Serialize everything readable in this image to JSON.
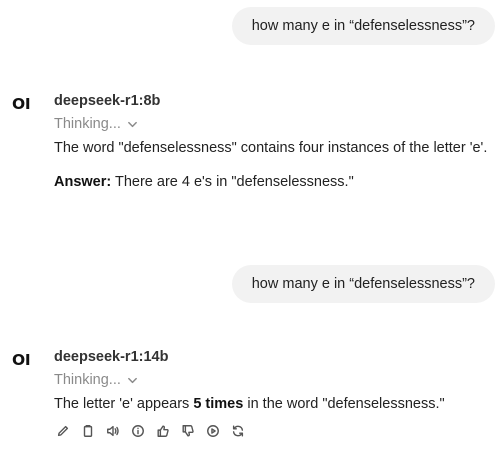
{
  "conversation": {
    "user_messages": [
      {
        "text": "how many e in “defenselessness”?"
      },
      {
        "text": "how many e in “defenselessness”?"
      }
    ],
    "assistant_messages": [
      {
        "avatar": "OI",
        "model": "deepseek-r1:8b",
        "thinking_label": "Thinking...",
        "text": "The word \"defenselessness\" contains four instances of the letter 'e'.",
        "answer_label": "Answer:",
        "answer_text": " There are 4 e's in \"defenselessness.\""
      },
      {
        "avatar": "OI",
        "model": "deepseek-r1:14b",
        "thinking_label": "Thinking...",
        "text_before": "The letter 'e' appears ",
        "text_bold": "5 times",
        "text_after": " in the word \"defenselessness.\""
      }
    ]
  },
  "actions": {
    "icons": [
      "edit-icon",
      "copy-icon",
      "read-aloud-icon",
      "info-icon",
      "thumbs-up-icon",
      "thumbs-down-icon",
      "continue-icon",
      "regenerate-icon"
    ]
  }
}
